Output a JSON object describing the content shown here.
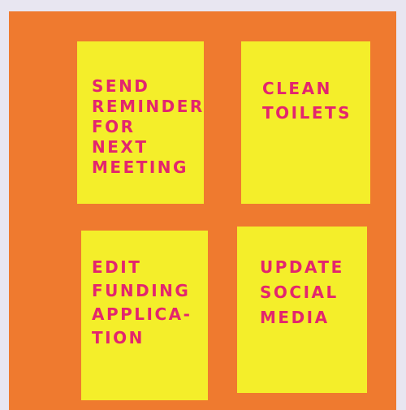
{
  "notes": [
    {
      "lines": [
        "SEND",
        "REMINDER",
        "FOR",
        "NEXT",
        "MEETING"
      ]
    },
    {
      "lines": [
        "CLEAN",
        "TOILETS"
      ]
    },
    {
      "lines": [
        "EDIT",
        "FUNDING",
        "APPLICA-",
        "TION"
      ]
    },
    {
      "lines": [
        "UPDATE",
        "SOCIAL",
        "MEDIA"
      ]
    }
  ],
  "colors": {
    "background": "#e8e6f1",
    "board": "#ef7a2f",
    "note": "#f4ee2a",
    "ink": "#e3256e"
  }
}
